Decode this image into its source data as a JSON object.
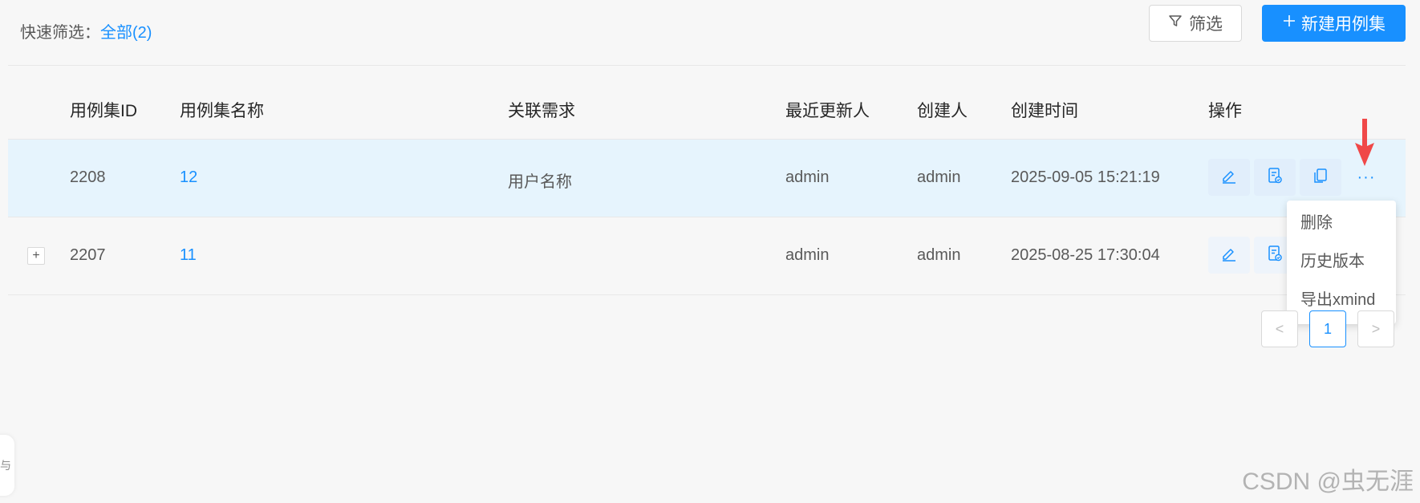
{
  "toolbar": {
    "quick_filter_label": "快速筛选：",
    "quick_filter_value": "全部(2)",
    "filter_button": "筛选",
    "new_button": "新建用例集"
  },
  "table": {
    "columns": [
      "用例集ID",
      "用例集名称",
      "关联需求",
      "最近更新人",
      "创建人",
      "创建时间",
      "操作"
    ],
    "rows": [
      {
        "id": "2208",
        "name": "12",
        "requirement": "用户名称",
        "updater": "admin",
        "creator": "admin",
        "created": "2025-09-05 15:21:19",
        "highlighted": true,
        "expandable": false
      },
      {
        "id": "2207",
        "name": "11",
        "requirement": "",
        "updater": "admin",
        "creator": "admin",
        "created": "2025-08-25 17:30:04",
        "highlighted": false,
        "expandable": true
      }
    ],
    "expand_symbol": "+",
    "more_symbol": "···"
  },
  "dropdown": {
    "items": [
      "删除",
      "历史版本",
      "导出xmind"
    ]
  },
  "pagination": {
    "prev": "<",
    "current": "1",
    "next": ">"
  },
  "side_handle_text": "与",
  "watermark": "CSDN @虫无涯",
  "colors": {
    "primary": "#1890ff",
    "row_highlight": "#e6f4fd",
    "annotation_arrow": "#f04848"
  },
  "icons": {
    "filter": "filter-icon",
    "plus": "plus-icon",
    "edit": "edit-icon",
    "execute": "document-check-icon",
    "copy": "copy-icon",
    "arrow": "red-arrow-annotation"
  }
}
